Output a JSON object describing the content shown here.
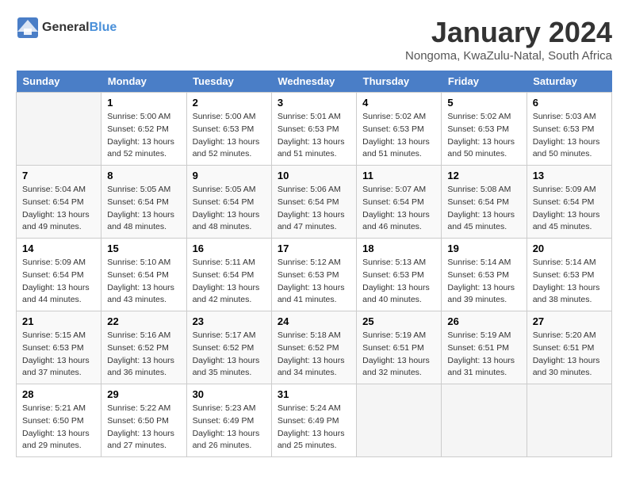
{
  "header": {
    "logo_general": "General",
    "logo_blue": "Blue",
    "title": "January 2024",
    "subtitle": "Nongoma, KwaZulu-Natal, South Africa"
  },
  "calendar": {
    "days_of_week": [
      "Sunday",
      "Monday",
      "Tuesday",
      "Wednesday",
      "Thursday",
      "Friday",
      "Saturday"
    ],
    "weeks": [
      [
        {
          "day": "",
          "info": ""
        },
        {
          "day": "1",
          "info": "Sunrise: 5:00 AM\nSunset: 6:52 PM\nDaylight: 13 hours\nand 52 minutes."
        },
        {
          "day": "2",
          "info": "Sunrise: 5:00 AM\nSunset: 6:53 PM\nDaylight: 13 hours\nand 52 minutes."
        },
        {
          "day": "3",
          "info": "Sunrise: 5:01 AM\nSunset: 6:53 PM\nDaylight: 13 hours\nand 51 minutes."
        },
        {
          "day": "4",
          "info": "Sunrise: 5:02 AM\nSunset: 6:53 PM\nDaylight: 13 hours\nand 51 minutes."
        },
        {
          "day": "5",
          "info": "Sunrise: 5:02 AM\nSunset: 6:53 PM\nDaylight: 13 hours\nand 50 minutes."
        },
        {
          "day": "6",
          "info": "Sunrise: 5:03 AM\nSunset: 6:53 PM\nDaylight: 13 hours\nand 50 minutes."
        }
      ],
      [
        {
          "day": "7",
          "info": "Sunrise: 5:04 AM\nSunset: 6:54 PM\nDaylight: 13 hours\nand 49 minutes."
        },
        {
          "day": "8",
          "info": "Sunrise: 5:05 AM\nSunset: 6:54 PM\nDaylight: 13 hours\nand 48 minutes."
        },
        {
          "day": "9",
          "info": "Sunrise: 5:05 AM\nSunset: 6:54 PM\nDaylight: 13 hours\nand 48 minutes."
        },
        {
          "day": "10",
          "info": "Sunrise: 5:06 AM\nSunset: 6:54 PM\nDaylight: 13 hours\nand 47 minutes."
        },
        {
          "day": "11",
          "info": "Sunrise: 5:07 AM\nSunset: 6:54 PM\nDaylight: 13 hours\nand 46 minutes."
        },
        {
          "day": "12",
          "info": "Sunrise: 5:08 AM\nSunset: 6:54 PM\nDaylight: 13 hours\nand 45 minutes."
        },
        {
          "day": "13",
          "info": "Sunrise: 5:09 AM\nSunset: 6:54 PM\nDaylight: 13 hours\nand 45 minutes."
        }
      ],
      [
        {
          "day": "14",
          "info": "Sunrise: 5:09 AM\nSunset: 6:54 PM\nDaylight: 13 hours\nand 44 minutes."
        },
        {
          "day": "15",
          "info": "Sunrise: 5:10 AM\nSunset: 6:54 PM\nDaylight: 13 hours\nand 43 minutes."
        },
        {
          "day": "16",
          "info": "Sunrise: 5:11 AM\nSunset: 6:54 PM\nDaylight: 13 hours\nand 42 minutes."
        },
        {
          "day": "17",
          "info": "Sunrise: 5:12 AM\nSunset: 6:53 PM\nDaylight: 13 hours\nand 41 minutes."
        },
        {
          "day": "18",
          "info": "Sunrise: 5:13 AM\nSunset: 6:53 PM\nDaylight: 13 hours\nand 40 minutes."
        },
        {
          "day": "19",
          "info": "Sunrise: 5:14 AM\nSunset: 6:53 PM\nDaylight: 13 hours\nand 39 minutes."
        },
        {
          "day": "20",
          "info": "Sunrise: 5:14 AM\nSunset: 6:53 PM\nDaylight: 13 hours\nand 38 minutes."
        }
      ],
      [
        {
          "day": "21",
          "info": "Sunrise: 5:15 AM\nSunset: 6:53 PM\nDaylight: 13 hours\nand 37 minutes."
        },
        {
          "day": "22",
          "info": "Sunrise: 5:16 AM\nSunset: 6:52 PM\nDaylight: 13 hours\nand 36 minutes."
        },
        {
          "day": "23",
          "info": "Sunrise: 5:17 AM\nSunset: 6:52 PM\nDaylight: 13 hours\nand 35 minutes."
        },
        {
          "day": "24",
          "info": "Sunrise: 5:18 AM\nSunset: 6:52 PM\nDaylight: 13 hours\nand 34 minutes."
        },
        {
          "day": "25",
          "info": "Sunrise: 5:19 AM\nSunset: 6:51 PM\nDaylight: 13 hours\nand 32 minutes."
        },
        {
          "day": "26",
          "info": "Sunrise: 5:19 AM\nSunset: 6:51 PM\nDaylight: 13 hours\nand 31 minutes."
        },
        {
          "day": "27",
          "info": "Sunrise: 5:20 AM\nSunset: 6:51 PM\nDaylight: 13 hours\nand 30 minutes."
        }
      ],
      [
        {
          "day": "28",
          "info": "Sunrise: 5:21 AM\nSunset: 6:50 PM\nDaylight: 13 hours\nand 29 minutes."
        },
        {
          "day": "29",
          "info": "Sunrise: 5:22 AM\nSunset: 6:50 PM\nDaylight: 13 hours\nand 27 minutes."
        },
        {
          "day": "30",
          "info": "Sunrise: 5:23 AM\nSunset: 6:49 PM\nDaylight: 13 hours\nand 26 minutes."
        },
        {
          "day": "31",
          "info": "Sunrise: 5:24 AM\nSunset: 6:49 PM\nDaylight: 13 hours\nand 25 minutes."
        },
        {
          "day": "",
          "info": ""
        },
        {
          "day": "",
          "info": ""
        },
        {
          "day": "",
          "info": ""
        }
      ]
    ]
  }
}
